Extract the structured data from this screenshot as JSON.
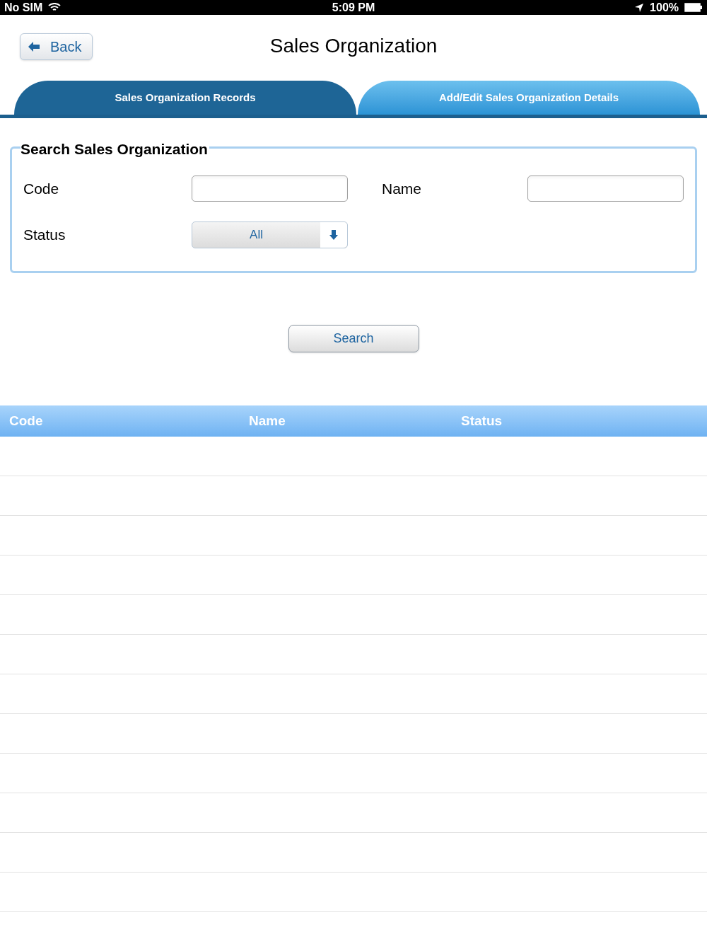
{
  "status_bar": {
    "carrier": "No SIM",
    "time": "5:09 PM",
    "battery": "100%"
  },
  "header": {
    "back": "Back",
    "title": "Sales Organization"
  },
  "tabs": [
    {
      "label": "Sales Organization Records",
      "selected": true
    },
    {
      "label": "Add/Edit Sales Organization Details",
      "selected": false
    }
  ],
  "search_panel": {
    "title": "Search Sales Organization",
    "code_label": "Code",
    "name_label": "Name",
    "status_label": "Status",
    "status_value": "All"
  },
  "search_button": "Search",
  "table": {
    "columns": [
      "Code",
      "Name",
      "Status"
    ]
  }
}
